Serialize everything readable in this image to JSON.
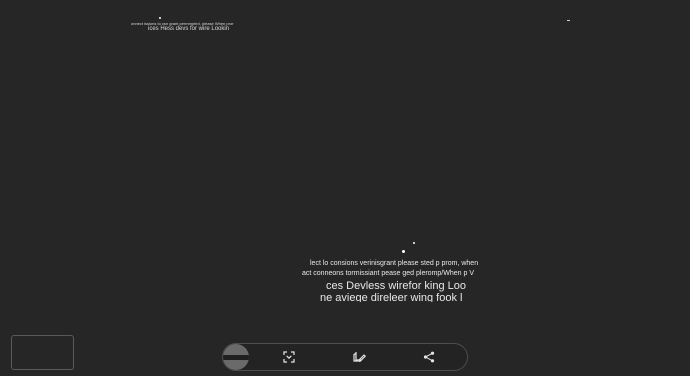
{
  "preview_top": {
    "line1": "onnect         issions to csn grant permmpted, please   When pror",
    "line2": "ices    Hess devs for wire  Lookin"
  },
  "preview_bottom": {
    "line1": "lect    lo consions verinisgrant please sted p prom, when",
    "line2": "act         conneons tormissiant pease ged pleromp/When p      V",
    "line3": "ces   Devless wirefor king Loo",
    "line4": "ne    aviege direleer wing fook       l"
  },
  "toolbar": {
    "buttons": [
      {
        "icon": "circle-thumbnail-icon"
      },
      {
        "icon": "scan-text-icon"
      },
      {
        "icon": "edit-icon"
      },
      {
        "icon": "share-icon"
      }
    ]
  }
}
